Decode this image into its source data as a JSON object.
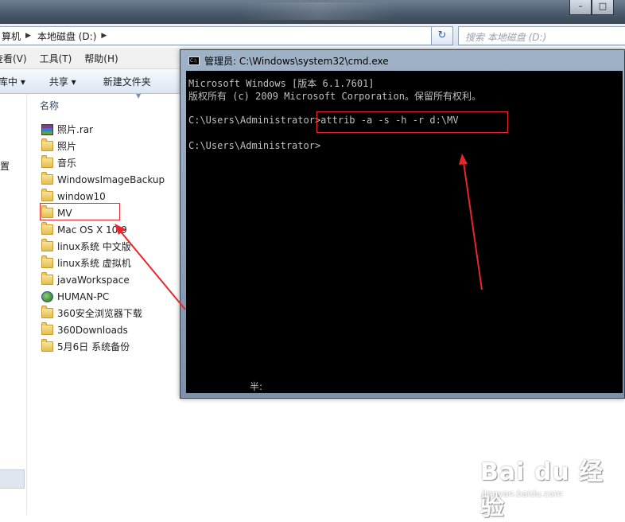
{
  "explorer": {
    "breadcrumb": [
      "算机",
      "本地磁盘 (D:)"
    ],
    "search_placeholder": "搜索 本地磁盘 (D:)",
    "menu": [
      "查看(V)",
      "工具(T)",
      "帮助(H)"
    ],
    "toolbar": [
      "库中 ▾",
      "共享 ▾",
      "新建文件夹"
    ],
    "column_header": "名称",
    "nav_location": "置",
    "files": [
      {
        "name": "照片.rar",
        "icon": "rar-archive-icon"
      },
      {
        "name": "照片",
        "icon": "folder-icon"
      },
      {
        "name": "音乐",
        "icon": "folder-icon"
      },
      {
        "name": "WindowsImageBackup",
        "icon": "folder-icon"
      },
      {
        "name": "window10",
        "icon": "folder-icon"
      },
      {
        "name": "MV",
        "icon": "folder-icon"
      },
      {
        "name": "Mac OS X 10.9",
        "icon": "folder-icon"
      },
      {
        "name": "linux系统  中文版",
        "icon": "folder-icon"
      },
      {
        "name": "linux系统  虚拟机",
        "icon": "folder-icon"
      },
      {
        "name": "javaWorkspace",
        "icon": "folder-icon"
      },
      {
        "name": "HUMAN-PC",
        "icon": "network-computer-icon"
      },
      {
        "name": "360安全浏览器下载",
        "icon": "folder-icon"
      },
      {
        "name": "360Downloads",
        "icon": "folder-icon"
      },
      {
        "name": "5月6日  系统备份",
        "icon": "folder-icon"
      }
    ]
  },
  "cmd": {
    "title": "管理员: C:\\Windows\\system32\\cmd.exe",
    "lines": [
      "Microsoft Windows [版本 6.1.7601]",
      "版权所有 (c) 2009 Microsoft Corporation。保留所有权利。",
      "",
      "C:\\Users\\Administrator>attrib -a -s -h -r d:\\MV",
      "",
      "C:\\Users\\Administrator>"
    ],
    "ime_status": "半:"
  },
  "watermark": {
    "logo": "Bai du 经验",
    "url": "jingyan.baidu.com"
  },
  "colors": {
    "highlight": "#e8262c",
    "console_bg": "#000000",
    "console_text": "#c0c0c0"
  }
}
